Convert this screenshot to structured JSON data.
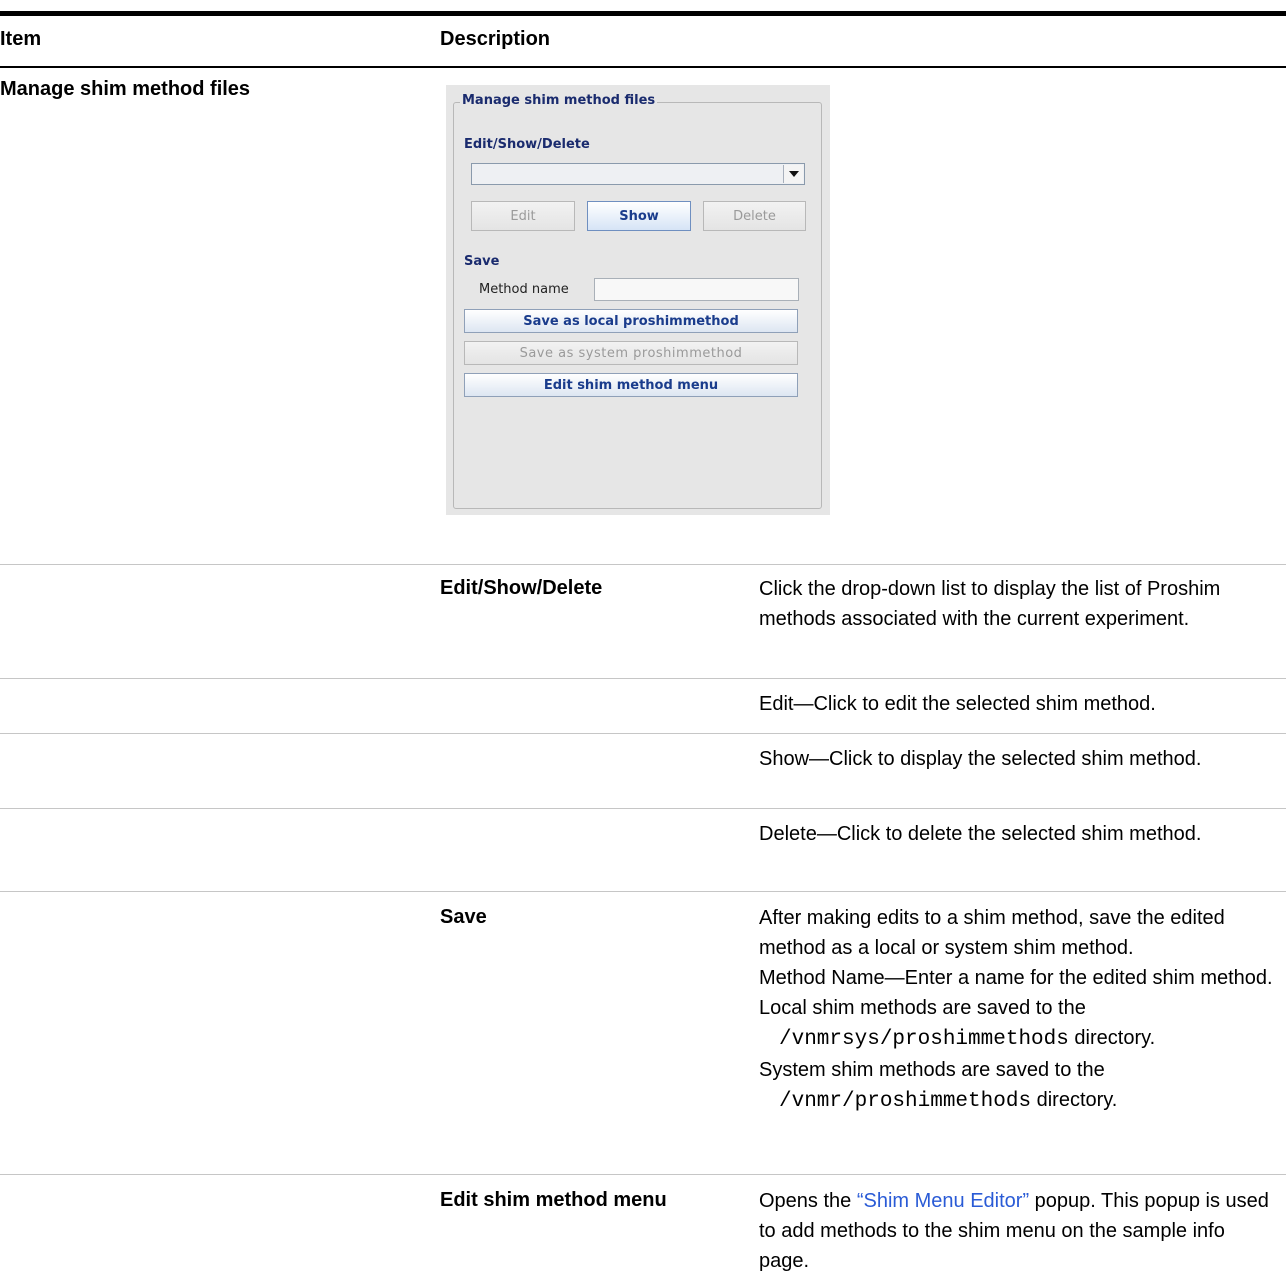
{
  "header": {
    "item": "Item",
    "description": "Description"
  },
  "section_title": "Manage shim method files",
  "panel": {
    "legend": "Manage shim method files",
    "edit_show_delete_label": "Edit/Show/Delete",
    "dropdown_value": "",
    "edit_button": "Edit",
    "show_button": "Show",
    "delete_button": "Delete",
    "save_label": "Save",
    "method_name_label": "Method name",
    "method_name_value": "",
    "save_local_button": "Save as local proshimmethod",
    "save_system_button": "Save as system proshimmethod",
    "edit_menu_button": "Edit shim method menu"
  },
  "rows": [
    {
      "sub": "Edit/Show/Delete",
      "desc": "Click the drop-down list to display the list of Proshim methods associated with the current experiment."
    },
    {
      "sub": "",
      "desc": "Edit—Click to edit the selected shim method."
    },
    {
      "sub": "",
      "desc": "Show—Click to display the selected shim method."
    },
    {
      "sub": "",
      "desc": "Delete—Click to delete the selected shim method."
    },
    {
      "sub": "Save",
      "desc_1": "After making edits to a shim method, save the edited method as a local or system shim method.",
      "desc_2": "Method Name—Enter a name for the edited shim method.",
      "desc_3": "Local shim methods are saved to the",
      "path_1": "/vnmrsys/proshimmethods",
      "dir_1": " directory.",
      "desc_4": "System shim methods are saved to the",
      "path_2": "/vnmr/proshimmethods",
      "dir_2": " directory."
    },
    {
      "sub": "Edit shim method menu",
      "desc_pre": "Opens the ",
      "link": "“Shim Menu Editor”",
      "desc_post": "  popup. This popup is used to add methods to the shim menu on the sample info page."
    }
  ]
}
